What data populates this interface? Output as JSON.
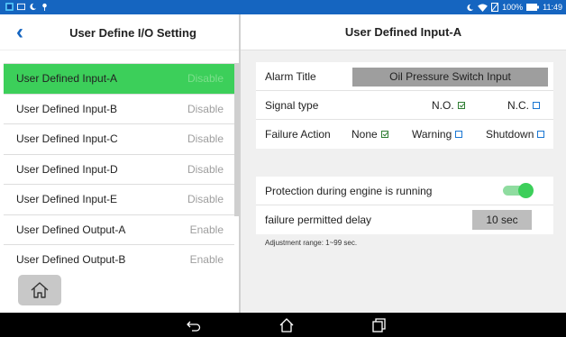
{
  "status_bar": {
    "battery": "100%",
    "time": "11:49",
    "icons": [
      "app-icon",
      "notification-icon",
      "moon-icon",
      "pin-icon",
      "moon-icon",
      "wifi-icon",
      "no-sim-icon",
      "battery-icon"
    ]
  },
  "left_panel": {
    "title": "User Define I/O Setting",
    "items": [
      {
        "label": "User Defined Input-A",
        "status": "Disable",
        "active": true
      },
      {
        "label": "User Defined Input-B",
        "status": "Disable"
      },
      {
        "label": "User Defined Input-C",
        "status": "Disable"
      },
      {
        "label": "User Defined Input-D",
        "status": "Disable"
      },
      {
        "label": "User Defined Input-E",
        "status": "Disable"
      },
      {
        "label": "User Defined Output-A",
        "status": "Enable"
      },
      {
        "label": "User Defined Output-B",
        "status": "Enable"
      }
    ]
  },
  "right_panel": {
    "title": "User Defined Input-A",
    "alarm_title_label": "Alarm Title",
    "alarm_title_value": "Oil Pressure Switch Input",
    "signal_type_label": "Signal type",
    "signal_no": "N.O.",
    "signal_nc": "N.C.",
    "failure_action_label": "Failure Action",
    "fa_none": "None",
    "fa_warning": "Warning",
    "fa_shutdown": "Shutdown",
    "protection_label": "Protection during engine is running",
    "protection_on": true,
    "delay_label": "failure permitted delay",
    "delay_value": "10 sec",
    "note": "Adjustment range: 1~99 sec."
  },
  "colors": {
    "accent": "#1565c0",
    "selected": "#3ccf5a"
  }
}
